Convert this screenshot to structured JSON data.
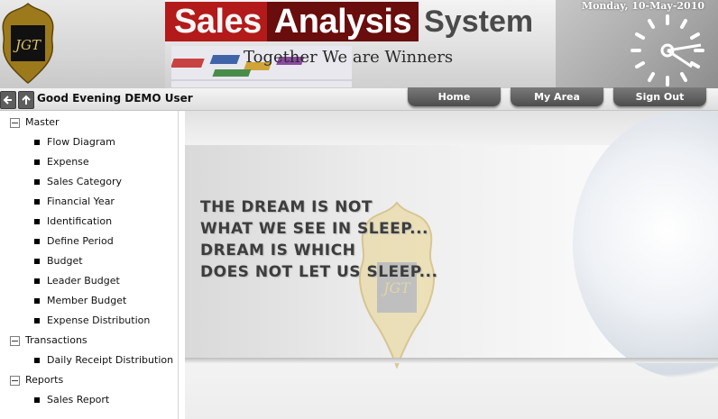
{
  "header": {
    "title_word1": "Sales",
    "title_word2": "Analysis",
    "title_word3": "System",
    "tagline": "Together We are Winners",
    "date": "Monday, 10-May-2010",
    "logo_text": "JGT",
    "logo_icon": "logo-emblem",
    "clock_icon": "clock-icon"
  },
  "nav": {
    "greeting": "Good Evening  DEMO User",
    "back_icon": "arrow-left-icon",
    "up_icon": "arrow-up-icon",
    "buttons": [
      "Home",
      "My Area",
      "Sign Out"
    ]
  },
  "sidebar": {
    "groups": [
      {
        "label": "Master",
        "items": [
          "Flow Diagram",
          "Expense",
          "Sales Category",
          "Financial Year",
          "Identification",
          "Define Period",
          "Budget",
          "Leader Budget",
          "Member Budget",
          "Expense Distribution"
        ]
      },
      {
        "label": "Transactions",
        "items": [
          "Daily Receipt Distribution"
        ]
      },
      {
        "label": "Reports",
        "items": [
          "Sales Report"
        ]
      }
    ]
  },
  "main": {
    "quote": [
      "THE DREAM IS NOT",
      "WHAT WE SEE IN SLEEP...",
      "DREAM IS WHICH",
      "DOES NOT LET US SLEEP..."
    ]
  },
  "colors": {
    "title_red": "#b31a1a",
    "title_dark_red": "#6a0d0d",
    "nav_button": "#5a5a5a"
  }
}
